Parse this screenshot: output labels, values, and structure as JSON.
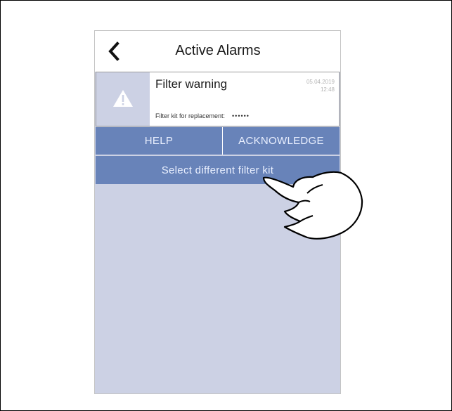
{
  "header": {
    "back_icon": "chevron-left-icon",
    "title": "Active Alarms"
  },
  "alarm": {
    "icon": "warning-triangle-icon",
    "title": "Filter warning",
    "date": "05.04.2019",
    "time": "12:48",
    "detail_label": "Filter kit for replacement:",
    "detail_value": "••••••"
  },
  "actions": {
    "help_label": "HELP",
    "acknowledge_label": "ACKNOWLEDGE",
    "select_kit_label": "Select different filter kit"
  },
  "colors": {
    "button": "#6883b9",
    "screen_background": "#ccd1e4",
    "button_text": "#eaf0ff"
  },
  "overlay": {
    "icon": "pointing-hand-icon"
  }
}
